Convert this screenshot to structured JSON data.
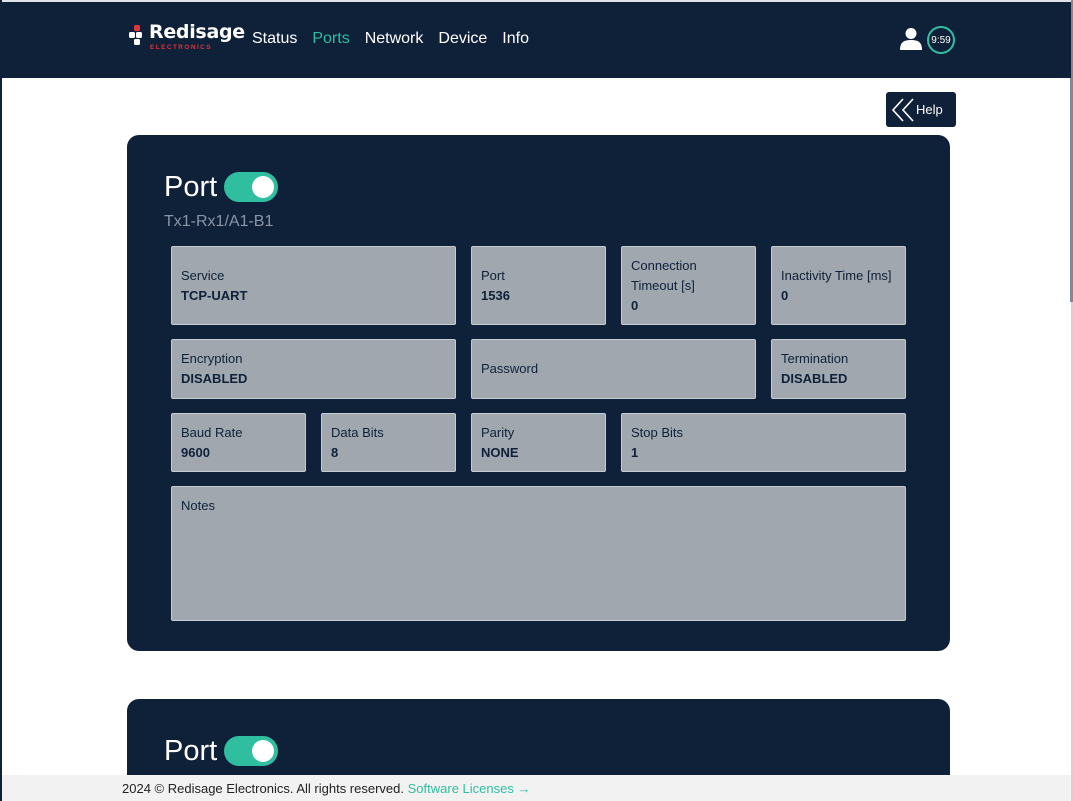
{
  "brand": {
    "name": "Redisage",
    "tagline": "ELECTRONICS",
    "accent_color": "#e0343c"
  },
  "nav": {
    "items": [
      {
        "label": "Status"
      },
      {
        "label": "Ports",
        "active": true
      },
      {
        "label": "Network"
      },
      {
        "label": "Device"
      },
      {
        "label": "Info"
      }
    ],
    "user_icon": "user-icon",
    "session_timer": "9:59"
  },
  "help": {
    "label": "Help",
    "icon": "double-chevron-left-icon"
  },
  "ports": [
    {
      "title": "Port",
      "enabled": true,
      "subtitle": "Tx1-Rx1/A1-B1",
      "fields": {
        "service": {
          "label": "Service",
          "value": "TCP-UART"
        },
        "port": {
          "label": "Port",
          "value": "1536"
        },
        "connection_timeout": {
          "label": "Connection Timeout [s]",
          "value": "0"
        },
        "inactivity_time": {
          "label": "Inactivity Time [ms]",
          "value": "0"
        },
        "encryption": {
          "label": "Encryption",
          "value": "DISABLED"
        },
        "password": {
          "label": "Password",
          "value": ""
        },
        "termination": {
          "label": "Termination",
          "value": "DISABLED"
        },
        "baud_rate": {
          "label": "Baud Rate",
          "value": "9600"
        },
        "data_bits": {
          "label": "Data Bits",
          "value": "8"
        },
        "parity": {
          "label": "Parity",
          "value": "NONE"
        },
        "stop_bits": {
          "label": "Stop Bits",
          "value": "1"
        },
        "notes": {
          "label": "Notes",
          "value": ""
        }
      }
    },
    {
      "title": "Port",
      "enabled": true
    }
  ],
  "footer": {
    "copyright": "2024 © Redisage Electronics. All rights reserved.",
    "link_label": "Software Licenses →"
  },
  "colors": {
    "navy": "#0f2039",
    "accent": "#2fbea0",
    "field_bg": "#a0a7ae"
  }
}
